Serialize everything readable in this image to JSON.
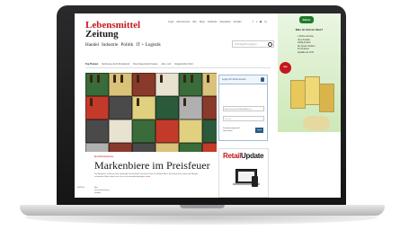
{
  "site": {
    "logo_line1": "Lebensmittel",
    "logo_line2": "Zeitung",
    "top_links": [
      "Login",
      "Abonnement",
      "Abo",
      "Shop",
      "Jobbörse",
      "Newsletter",
      "Kontakt"
    ],
    "social_icons": [
      "facebook-icon",
      "twitter-icon",
      "rss-icon",
      "linkedin-icon",
      "xing-icon"
    ],
    "nav": [
      "Handel",
      "Industrie",
      "Politik",
      "IT + Logistik"
    ],
    "search_placeholder": "Suchbegriff eingeben...",
    "subnav": [
      "Top-Themen",
      "Sortimente durch Preiskampf",
      "Streit Supermarkt Kunden",
      "Aldi + Lidl",
      "Vorgeschichte Wort"
    ]
  },
  "login": {
    "title": "Login für Abonnenten",
    "username_placeholder": "Benutzername/E-Mail-Adresse",
    "password_value": "••••••••••",
    "links": [
      "Passwort vergessen?",
      "Jetzt testen!"
    ],
    "button": "Login"
  },
  "article": {
    "tag": "Einzelhandelspreise",
    "headline": "Markenbiere im Preisfeuer",
    "teaser": "Der Bierpreis ist derzeit hart umkämpft: Der Handel senkt die Preise für Markenbiere, die Brauereien sehen die Margen schwinden. Mehr dazu lesen Sie in der aktuellen Ausgabe.",
    "more": "mehr",
    "sidebar_label": "ANZEIGE",
    "tags": [
      "Bier",
      "Preisentwicklung",
      "Handel"
    ]
  },
  "ad": {
    "brand": "Kühne",
    "title": "Was ist drin im Glas?",
    "bullets": [
      "1 Kühne Gemüse",
      "ohne Zusätze",
      "kräftig & frisch",
      "Die besten Zutaten",
      "für Ihr Essen",
      "Qualität seit 1722"
    ],
    "badge": "NEU"
  },
  "retail": {
    "logo_part1": "Retail",
    "logo_part2": "Update"
  }
}
